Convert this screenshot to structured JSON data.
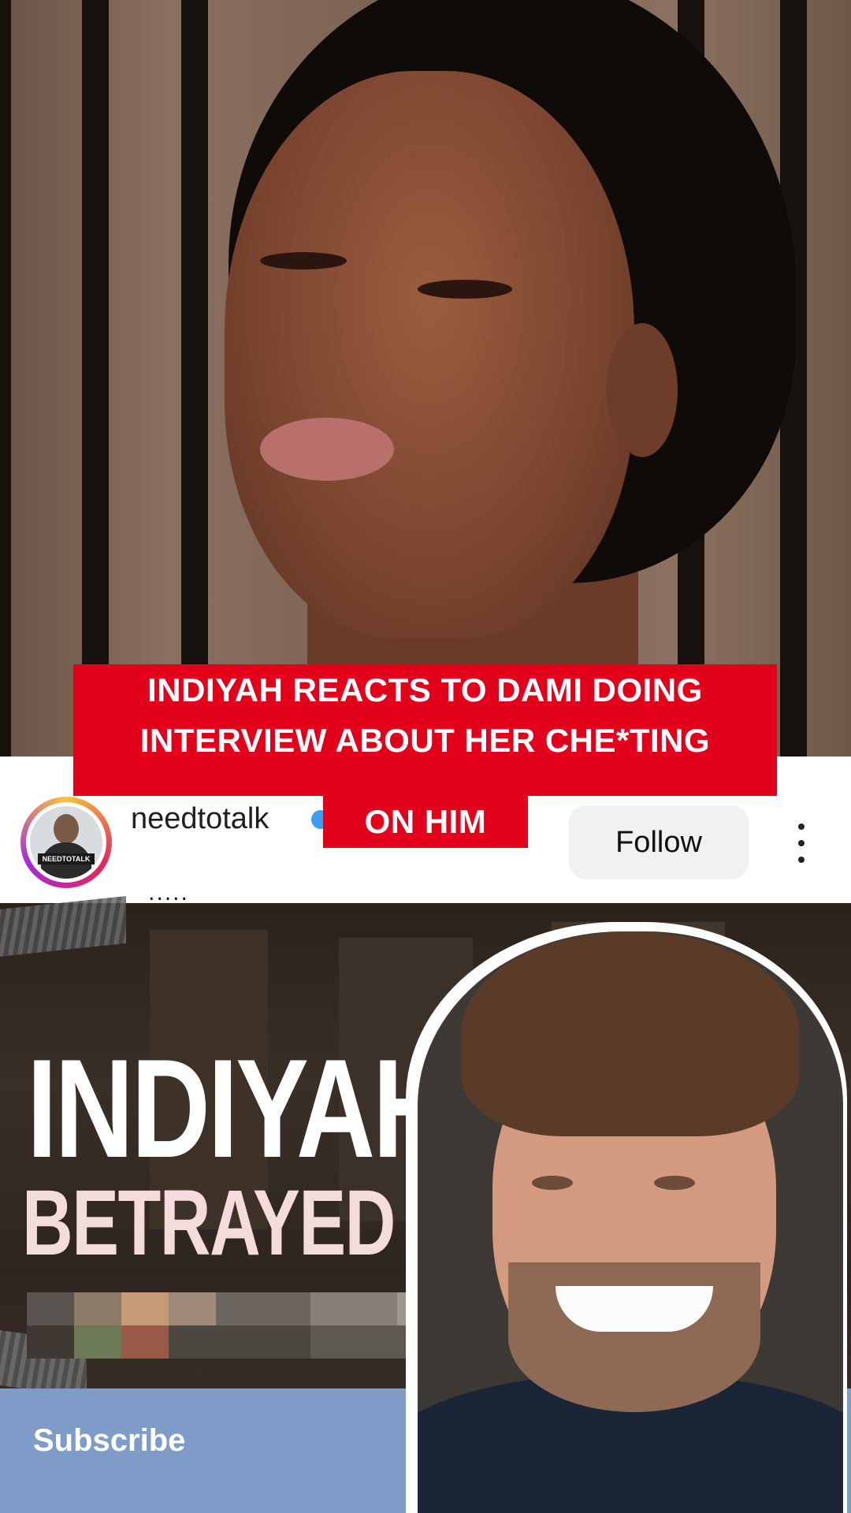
{
  "caption": {
    "line1": "INDIYAH REACTS TO DAMI DOING",
    "line2": "INTERVIEW ABOUT HER CHE*TING",
    "line3": "ON HIM"
  },
  "profile": {
    "username": "needtotalk",
    "avatar_badge": "NEEDTOTALK",
    "follow_label": "Follow",
    "more_icon": "more-vertical-icon",
    "dots_text": "....."
  },
  "thumbnail": {
    "title": "INDIYAH",
    "subtitle": "BETRAYED ME",
    "subscribe_label": "Subscribe"
  },
  "colors": {
    "caption_bg": "#e2001b",
    "follow_bg": "#f0f1f3",
    "subscribe_bg": "#7e9cc7",
    "verified": "#3c9df0"
  }
}
